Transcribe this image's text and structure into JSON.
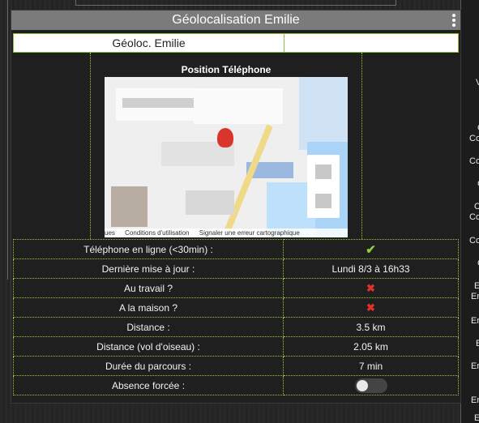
{
  "widget": {
    "title": "Géolocalisation Emilie",
    "subtitle": "Géoloc. Emilie",
    "map_label": "Position Téléphone",
    "map_credits": [
      "ues",
      "Conditions d'utilisation",
      "Signaler une erreur cartographique"
    ]
  },
  "info_rows": [
    {
      "label": "Téléphone en ligne (<30min) :",
      "value": "✔",
      "kind": "ok",
      "icon": "check-icon"
    },
    {
      "label": "Dernière mise à jour :",
      "value": "Lundi 8/3 à 16h33",
      "kind": "text"
    },
    {
      "label": "Au travail ?",
      "value": "✖",
      "kind": "ko",
      "icon": "cross-icon"
    },
    {
      "label": "A la maison ?",
      "value": "✖",
      "kind": "ko",
      "icon": "cross-icon"
    },
    {
      "label": "Distance :",
      "value": "3.5 km",
      "kind": "text"
    },
    {
      "label": "Distance (vol d'oiseau) :",
      "value": "2.05 km",
      "kind": "text"
    },
    {
      "label": "Durée du parcours :",
      "value": "7 min",
      "kind": "text"
    },
    {
      "label": "Absence forcée :",
      "value": "",
      "kind": "toggle",
      "toggle_on": false
    }
  ],
  "right_panel_fragments": [
    "V",
    "C",
    "Co",
    "Co",
    "C",
    "C",
    "Co",
    "Co",
    "C",
    "E",
    "Em",
    "En",
    "E",
    "En",
    "Er",
    "En",
    "E"
  ],
  "colors": {
    "accent": "#9ccc3a",
    "ok": "#8bd13a",
    "ko": "#e0322a",
    "title_bar": "#7b7b7b"
  }
}
